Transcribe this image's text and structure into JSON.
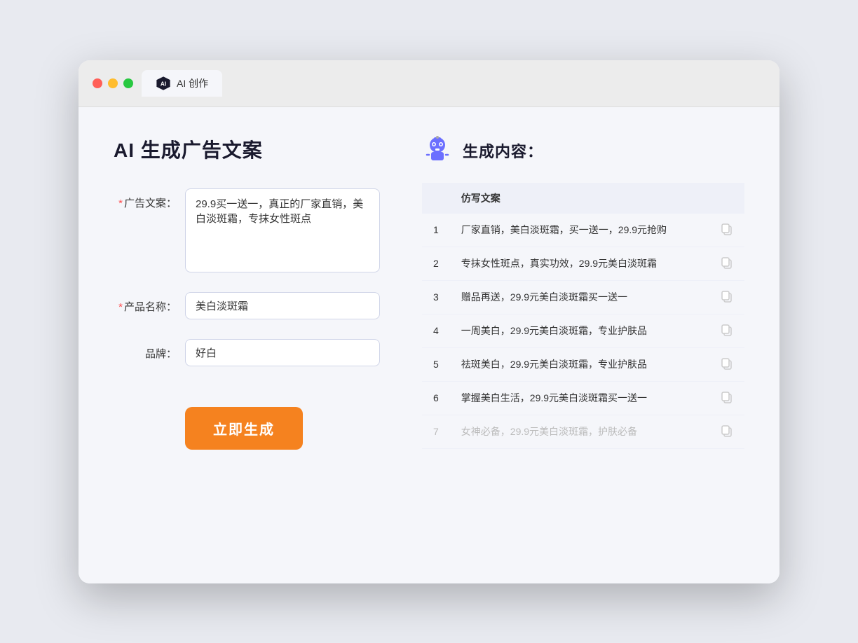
{
  "browser": {
    "tab_title": "AI 创作"
  },
  "page": {
    "title": "AI 生成广告文案",
    "form": {
      "ad_copy_label": "广告文案：",
      "ad_copy_required": "*",
      "ad_copy_value": "29.9买一送一，真正的厂家直销，美白淡斑霜，专抹女性斑点",
      "product_name_label": "产品名称：",
      "product_name_required": "*",
      "product_name_value": "美白淡斑霜",
      "brand_label": "品牌：",
      "brand_value": "好白",
      "generate_btn_label": "立即生成"
    },
    "right": {
      "title": "生成内容：",
      "table_header": "仿写文案",
      "results": [
        {
          "id": 1,
          "text": "厂家直销，美白淡斑霜，买一送一，29.9元抢购",
          "faded": false
        },
        {
          "id": 2,
          "text": "专抹女性斑点，真实功效，29.9元美白淡斑霜",
          "faded": false
        },
        {
          "id": 3,
          "text": "赠品再送，29.9元美白淡斑霜买一送一",
          "faded": false
        },
        {
          "id": 4,
          "text": "一周美白，29.9元美白淡斑霜，专业护肤品",
          "faded": false
        },
        {
          "id": 5,
          "text": "祛斑美白，29.9元美白淡斑霜，专业护肤品",
          "faded": false
        },
        {
          "id": 6,
          "text": "掌握美白生活，29.9元美白淡斑霜买一送一",
          "faded": false
        },
        {
          "id": 7,
          "text": "女神必备，29.9元美白淡斑霜，护肤必备",
          "faded": true
        }
      ]
    }
  }
}
